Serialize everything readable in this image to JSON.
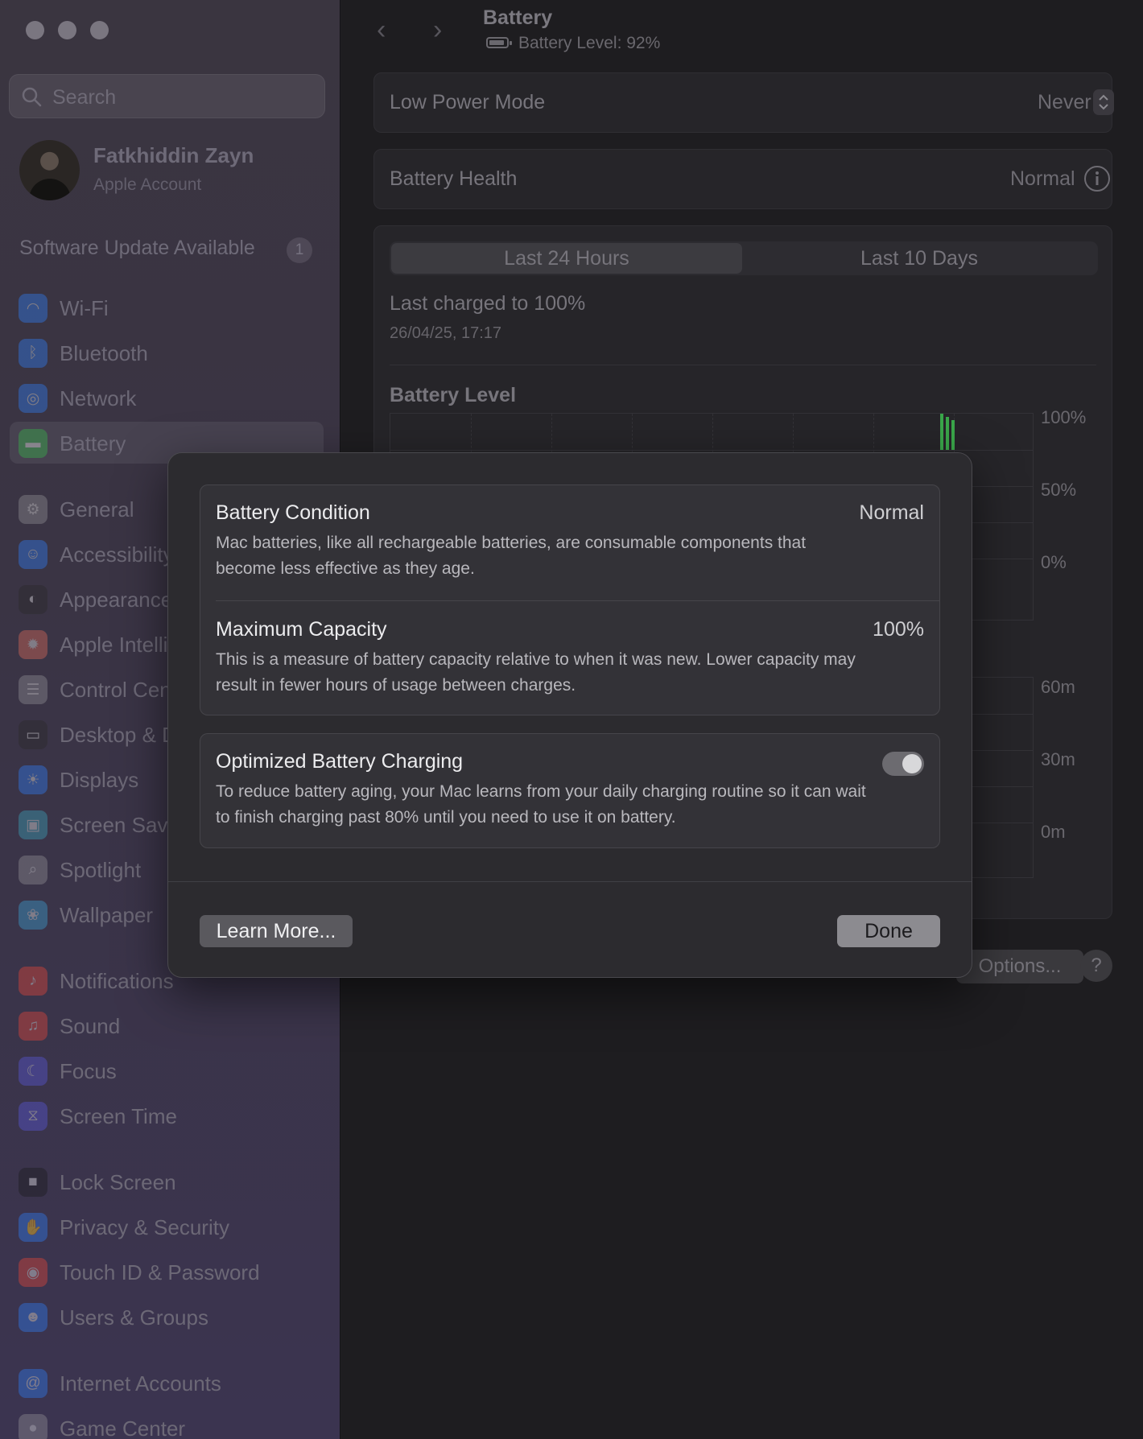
{
  "sidebar": {
    "search_placeholder": "Search",
    "account": {
      "name": "Fatkhiddin Zayn",
      "subtitle": "Apple Account"
    },
    "update": {
      "label": "Software Update Available",
      "badge": "1"
    },
    "items": [
      {
        "label": "Wi-Fi",
        "icon": "wifi-icon",
        "color": "#2f7bf0"
      },
      {
        "label": "Bluetooth",
        "icon": "bluetooth-icon",
        "color": "#2f7bf0"
      },
      {
        "label": "Network",
        "icon": "globe-icon",
        "color": "#2f7bf0"
      },
      {
        "label": "Battery",
        "icon": "battery-icon",
        "color": "#38b24a"
      },
      {
        "label": "General",
        "icon": "gear-icon",
        "color": "#8e8e93"
      },
      {
        "label": "Accessibility",
        "icon": "accessibility-icon",
        "color": "#2f7bf0"
      },
      {
        "label": "Appearance",
        "icon": "appearance-icon",
        "color": "#2a2a2a"
      },
      {
        "label": "Apple Intelligence & Siri",
        "icon": "siri-icon",
        "color": "#d86a5a"
      },
      {
        "label": "Control Centre",
        "icon": "control-centre-icon",
        "color": "#8e8e93"
      },
      {
        "label": "Desktop & Dock",
        "icon": "dock-icon",
        "color": "#2a2a2a"
      },
      {
        "label": "Displays",
        "icon": "sun-icon",
        "color": "#2f7bf0"
      },
      {
        "label": "Screen Saver",
        "icon": "screensaver-icon",
        "color": "#3aa0b8"
      },
      {
        "label": "Spotlight",
        "icon": "spotlight-icon",
        "color": "#8e8e93"
      },
      {
        "label": "Wallpaper",
        "icon": "wallpaper-icon",
        "color": "#3a9ed0"
      },
      {
        "label": "Notifications",
        "icon": "bell-icon",
        "color": "#e0453a"
      },
      {
        "label": "Sound",
        "icon": "speaker-icon",
        "color": "#e0453a"
      },
      {
        "label": "Focus",
        "icon": "moon-icon",
        "color": "#5856d6"
      },
      {
        "label": "Screen Time",
        "icon": "hourglass-icon",
        "color": "#5856d6"
      },
      {
        "label": "Lock Screen",
        "icon": "lock-icon",
        "color": "#1c1c1e"
      },
      {
        "label": "Privacy & Security",
        "icon": "hand-icon",
        "color": "#2f7bf0"
      },
      {
        "label": "Touch ID & Password",
        "icon": "fingerprint-icon",
        "color": "#e0453a"
      },
      {
        "label": "Users & Groups",
        "icon": "users-icon",
        "color": "#2f7bf0"
      },
      {
        "label": "Internet Accounts",
        "icon": "at-icon",
        "color": "#2f7bf0"
      },
      {
        "label": "Game Center",
        "icon": "gamecenter-icon",
        "color": "#8e8e93"
      }
    ]
  },
  "header": {
    "title": "Battery",
    "subtitle": "Battery Level: 92%",
    "battery_level": 0.92
  },
  "settings": {
    "low_power": {
      "label": "Low Power Mode",
      "value": "Never"
    },
    "health": {
      "label": "Battery Health",
      "value": "Normal"
    }
  },
  "usage": {
    "tabs": [
      "Last 24 Hours",
      "Last 10 Days"
    ],
    "active_tab": 0,
    "last_charged": "Last charged to 100%",
    "last_charged_time": "26/04/25, 17:17",
    "chart_title": "Battery Level",
    "level_ticks": [
      "100%",
      "50%",
      "0%"
    ],
    "usage_ticks": [
      "60m",
      "30m",
      "0m"
    ],
    "options_label": "Options...",
    "help_label": "?",
    "bar_color": "#3aa64a"
  },
  "dialog": {
    "condition": {
      "title": "Battery Condition",
      "value": "Normal",
      "description": "Mac batteries, like all rechargeable batteries, are consumable components that become less effective as they age."
    },
    "capacity": {
      "title": "Maximum Capacity",
      "value": "100%",
      "description": "This is a measure of battery capacity relative to when it was new. Lower capacity may result in fewer hours of usage between charges."
    },
    "optimized": {
      "title": "Optimized Battery Charging",
      "enabled": true,
      "description": "To reduce battery aging, your Mac learns from your daily charging routine so it can wait to finish charging past 80% until you need to use it on battery."
    },
    "learn_more_label": "Learn More...",
    "done_label": "Done"
  }
}
